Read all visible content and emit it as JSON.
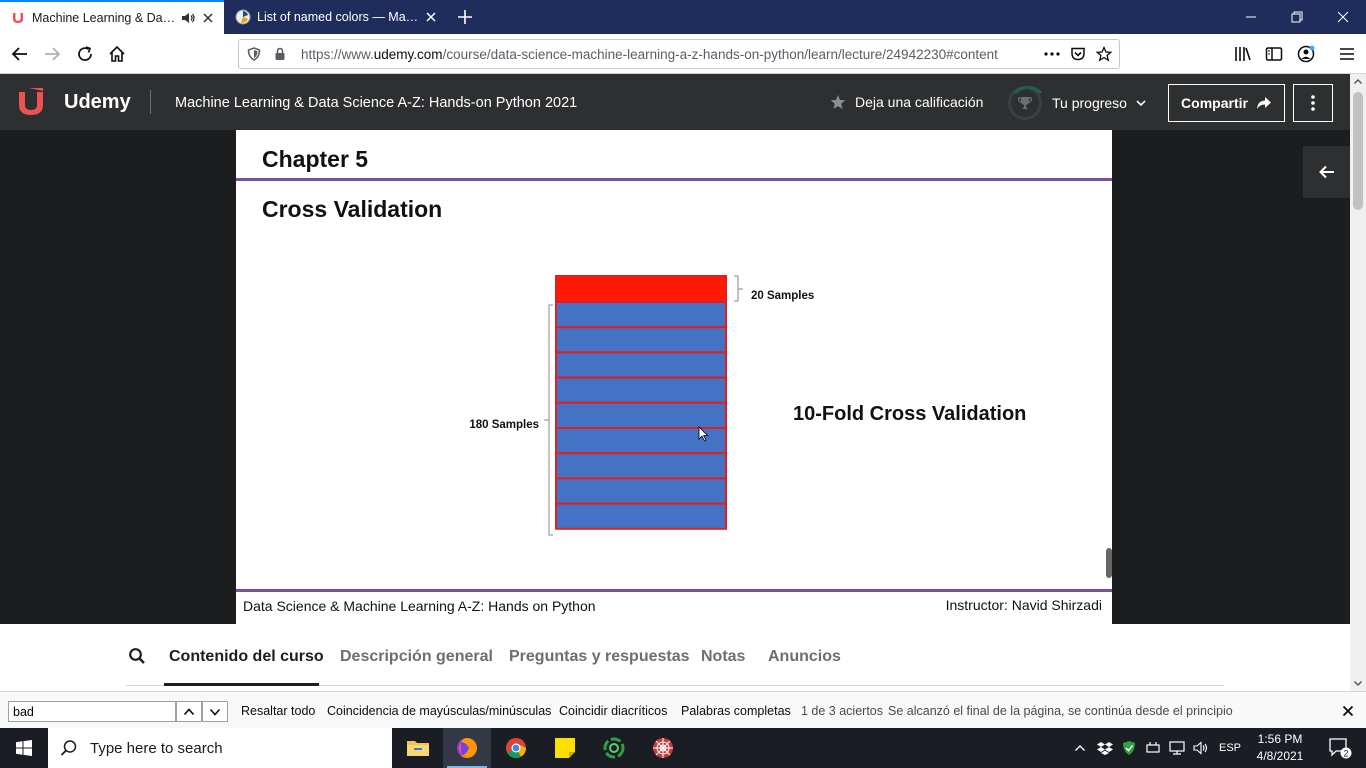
{
  "browser": {
    "tabs": [
      {
        "title": "Machine Learning & Data Sc",
        "active": true
      },
      {
        "title": "List of named colors — Matplo",
        "active": false
      }
    ],
    "url_prefix": "https://www.",
    "url_domain": "udemy.com",
    "url_path": "/course/data-science-machine-learning-a-z-hands-on-python/learn/lecture/24942230#content",
    "accent": "#0a84ff",
    "tabstrip_color": "#1f2d5c"
  },
  "udemy": {
    "logo_text": "Udemy",
    "course_title": "Machine Learning & Data Science A-Z: Hands-on Python 2021",
    "rate_label": "Deja una calificación",
    "progress_label": "Tu progreso",
    "share_label": "Compartir",
    "brand_color": "#ec5252"
  },
  "slide": {
    "chapter": "Chapter 5",
    "heading": "Cross Validation",
    "test_label": "20 Samples",
    "train_label": "180 Samples",
    "fold_title": "10-Fold Cross Validation",
    "footer_left": "Data Science & Machine Learning A-Z: Hands on Python",
    "footer_right": "Instructor: Navid Shirzadi",
    "test_block_count": 1,
    "train_block_count": 9,
    "test_color": "#ff1a05",
    "train_color": "#4472c4",
    "border_color": "#e02020",
    "rule_color": "#7b519d"
  },
  "course_tabs": [
    {
      "label": "Contenido del curso",
      "active": true
    },
    {
      "label": "Descripción general",
      "active": false
    },
    {
      "label": "Preguntas y respuestas",
      "active": false
    },
    {
      "label": "Notas",
      "active": false
    },
    {
      "label": "Anuncios",
      "active": false
    }
  ],
  "findbar": {
    "query": "bad",
    "highlight_all": "Resaltar todo",
    "match_case": "Coincidencia de mayúsculas/minúsculas",
    "match_diacritics": "Coincidir diacríticos",
    "whole_words": "Palabras completas",
    "match_count": "1 de 3 aciertos",
    "status_message": "Se alcanzó el final de la página, se continúa desde el principio"
  },
  "taskbar": {
    "search_placeholder": "Type here to search",
    "language": "ESP",
    "time": "1:56 PM",
    "date": "4/8/2021",
    "notification_count": "2",
    "apps": [
      "file-explorer",
      "firefox",
      "chrome",
      "sticky-notes",
      "circular-app",
      "spider-app"
    ]
  }
}
